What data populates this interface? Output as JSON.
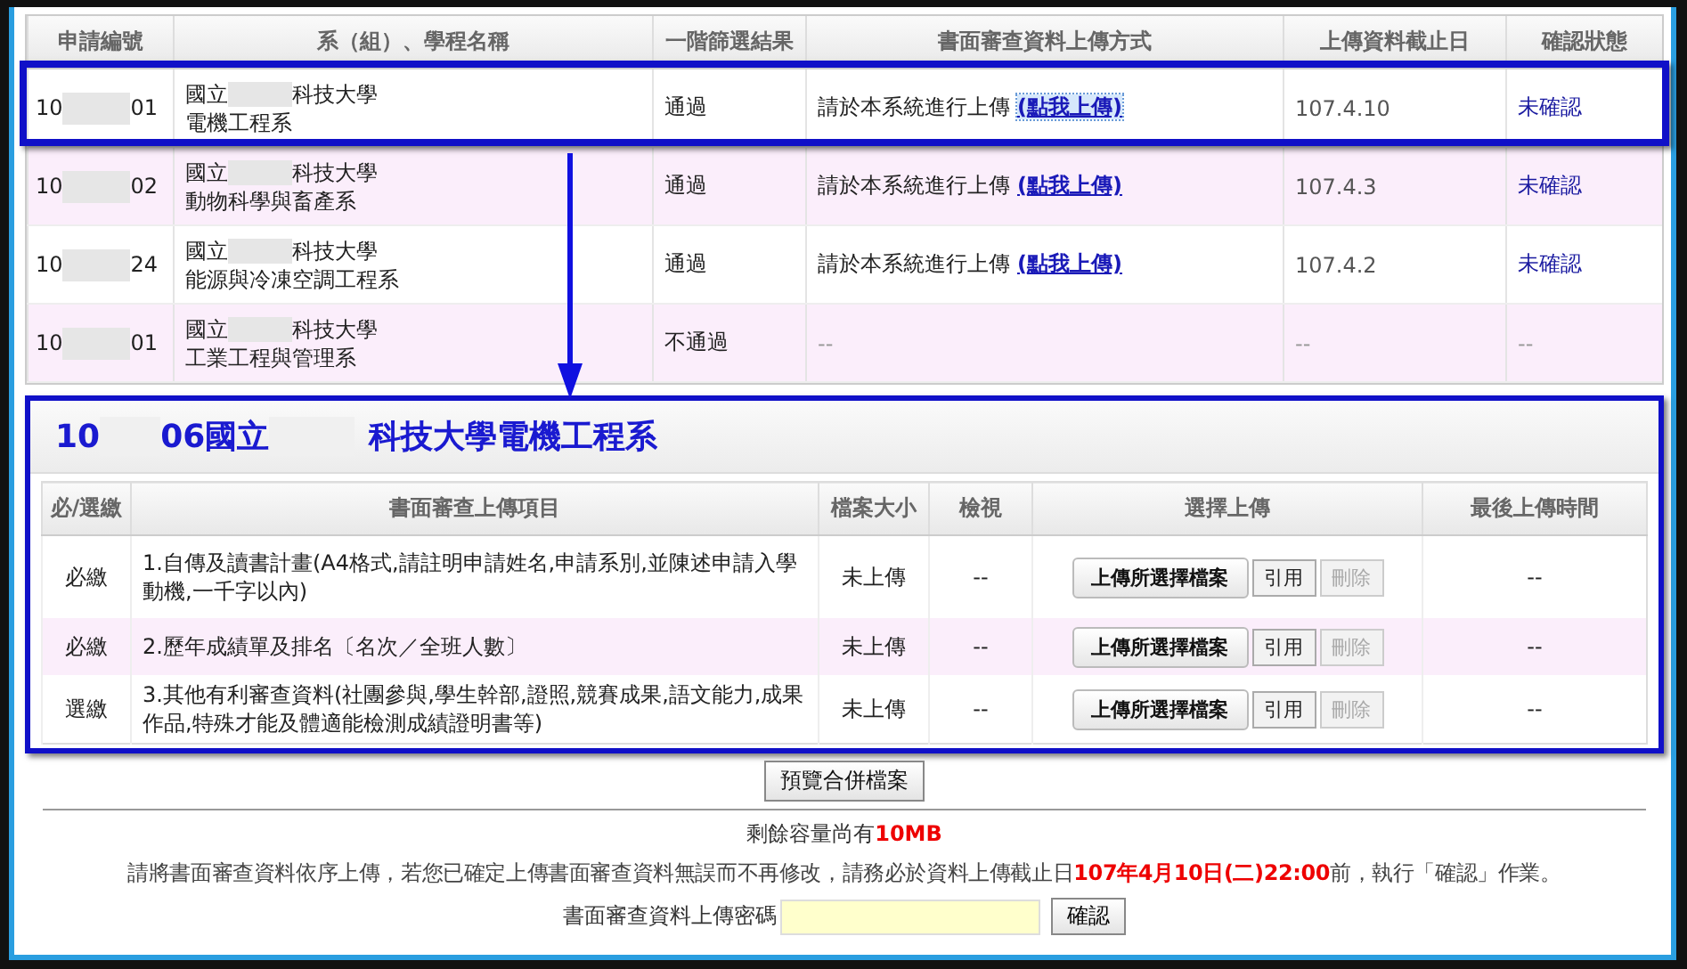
{
  "applications": {
    "columns": [
      "申請編號",
      "系（組）、學程名稱",
      "一階篩選結果",
      "書面審查資料上傳方式",
      "上傳資料截止日",
      "確認狀態"
    ],
    "rows": [
      {
        "id_start": "10",
        "id_end": "01",
        "school_start": "國立",
        "school_end": "科技大學",
        "department": "電機工程系",
        "result": "通過",
        "method": "請於本系統進行上傳",
        "link": "(點我上傳)",
        "link_focused": true,
        "deadline": "107.4.10",
        "status": "未確認",
        "marked": true
      },
      {
        "id_start": "10",
        "id_end": "02",
        "school_start": "國立",
        "school_end": "科技大學",
        "department": "動物科學與畜產系",
        "result": "通過",
        "method": "請於本系統進行上傳",
        "link": "(點我上傳)",
        "link_focused": false,
        "deadline": "107.4.3",
        "status": "未確認",
        "marked": false
      },
      {
        "id_start": "10",
        "id_end": "24",
        "school_start": "國立",
        "school_end": "科技大學",
        "department": "能源與冷凍空調工程系",
        "result": "通過",
        "method": "請於本系統進行上傳",
        "link": "(點我上傳)",
        "link_focused": false,
        "deadline": "107.4.2",
        "status": "未確認",
        "marked": false
      },
      {
        "id_start": "10",
        "id_end": "01",
        "school_start": "國立",
        "school_end": "科技大學",
        "department": "工業工程與管理系",
        "result": "不通過",
        "method": "--",
        "deadline": "--",
        "status": "--",
        "marked": false
      }
    ]
  },
  "upload_section": {
    "title_start": "10",
    "title_mid": "06國立",
    "title_end": "科技大學電機工程系",
    "columns": [
      "必/選繳",
      "書面審查上傳項目",
      "檔案大小",
      "檢視",
      "選擇上傳",
      "最後上傳時間"
    ],
    "items": [
      {
        "requirement": "必繳",
        "name": "1.自傳及讀書計畫(A4格式,請註明申請姓名,申請系別,並陳述申請入學動機,一千字以內)",
        "size": "未上傳",
        "view": "--",
        "upload_button": "上傳所選擇檔案",
        "cite_button": "引用",
        "delete_button": "刪除",
        "delete_disabled": true,
        "last_upload": "--"
      },
      {
        "requirement": "必繳",
        "name": "2.歷年成績單及排名〔名次／全班人數〕",
        "size": "未上傳",
        "view": "--",
        "upload_button": "上傳所選擇檔案",
        "cite_button": "引用",
        "delete_button": "刪除",
        "delete_disabled": true,
        "last_upload": "--"
      },
      {
        "requirement": "選繳",
        "name": "3.其他有利審查資料(社團參與,學生幹部,證照,競賽成果,語文能力,成果作品,特殊才能及體適能檢測成績證明書等)",
        "size": "未上傳",
        "view": "--",
        "upload_button": "上傳所選擇檔案",
        "cite_button": "引用",
        "delete_button": "刪除",
        "delete_disabled": true,
        "last_upload": "--"
      }
    ]
  },
  "preview_button": "預覽合併檔案",
  "capacity": {
    "label": "剩餘容量尚有",
    "value": "10MB"
  },
  "notice": {
    "before": "請將書面審查資料依序上傳，若您已確定上傳書面審查資料無誤而不再修改，請務必於資料上傳截止日",
    "deadline": "107年4月10日(二)22:00",
    "after": "前，執行「確認」作業。"
  },
  "password": {
    "label": "書面審查資料上傳密碼",
    "button": "確認"
  }
}
